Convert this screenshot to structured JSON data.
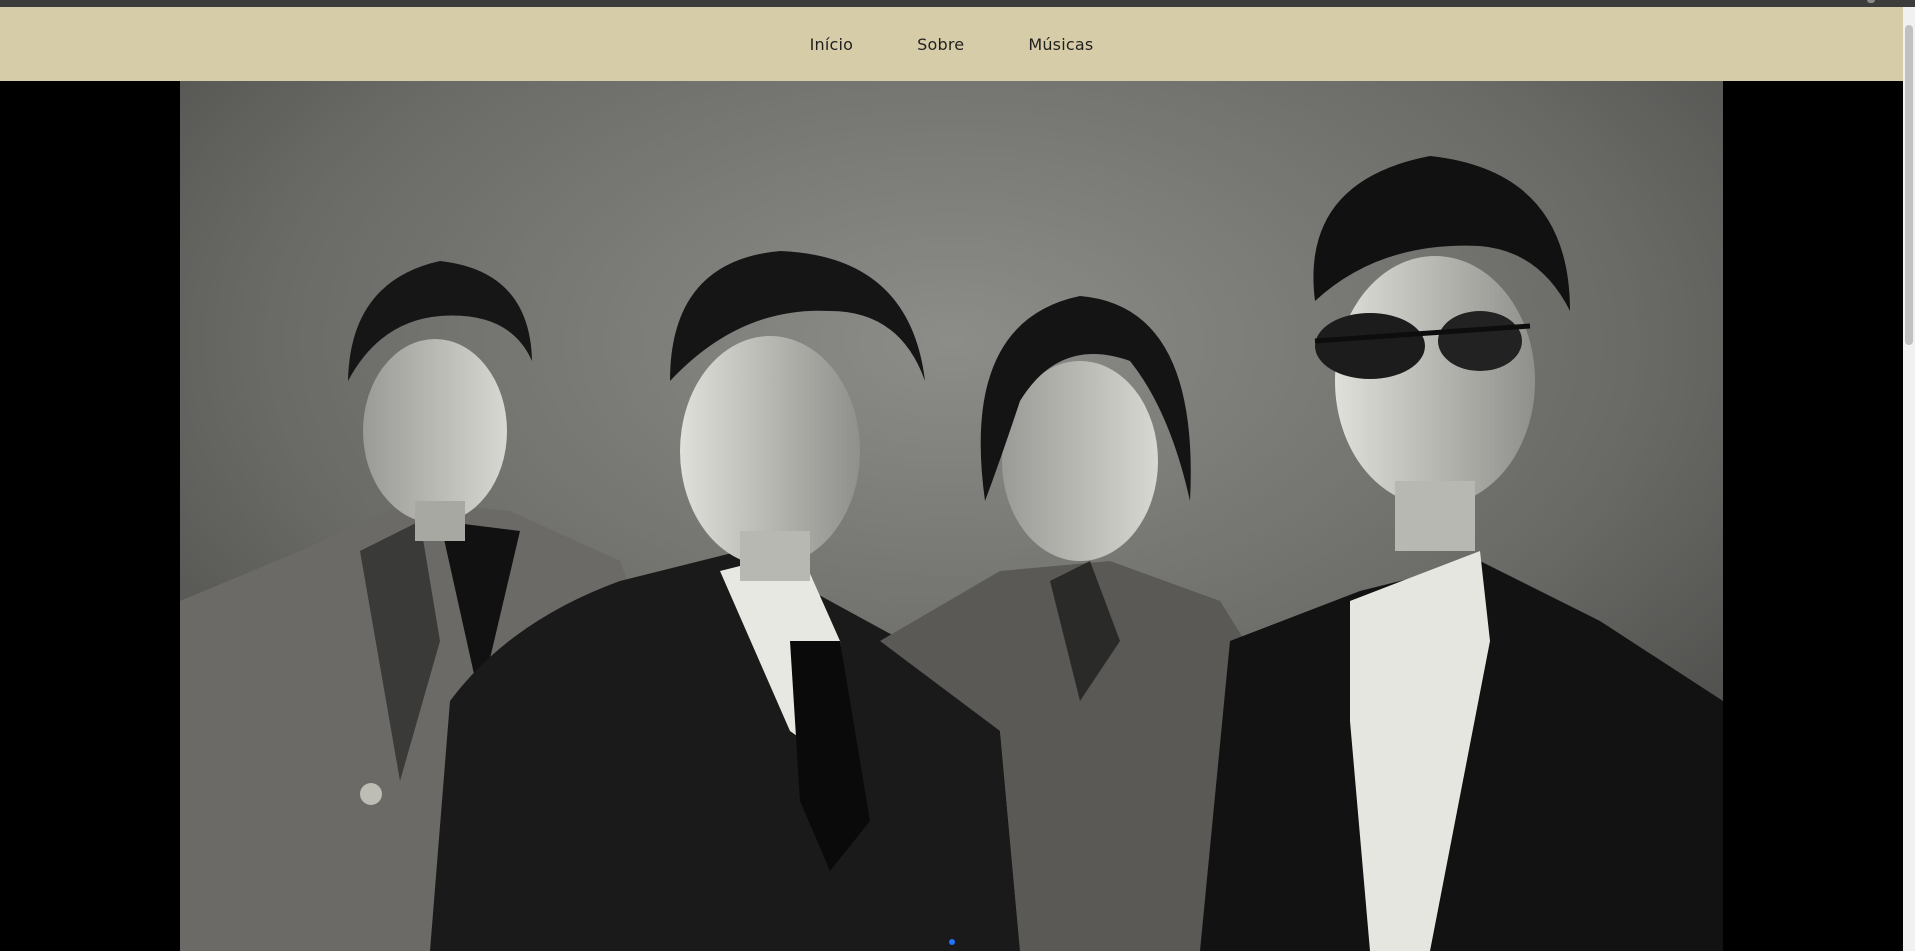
{
  "nav": {
    "items": [
      {
        "label": "Início"
      },
      {
        "label": "Sobre"
      },
      {
        "label": "Músicas"
      }
    ]
  },
  "colors": {
    "navbar_bg": "#d6cda8",
    "page_bg": "#000000",
    "indicator": "#1e73ff"
  },
  "carousel": {
    "image": "black-and-white-band-photo",
    "slide_count": 1,
    "active_slide": 1
  }
}
